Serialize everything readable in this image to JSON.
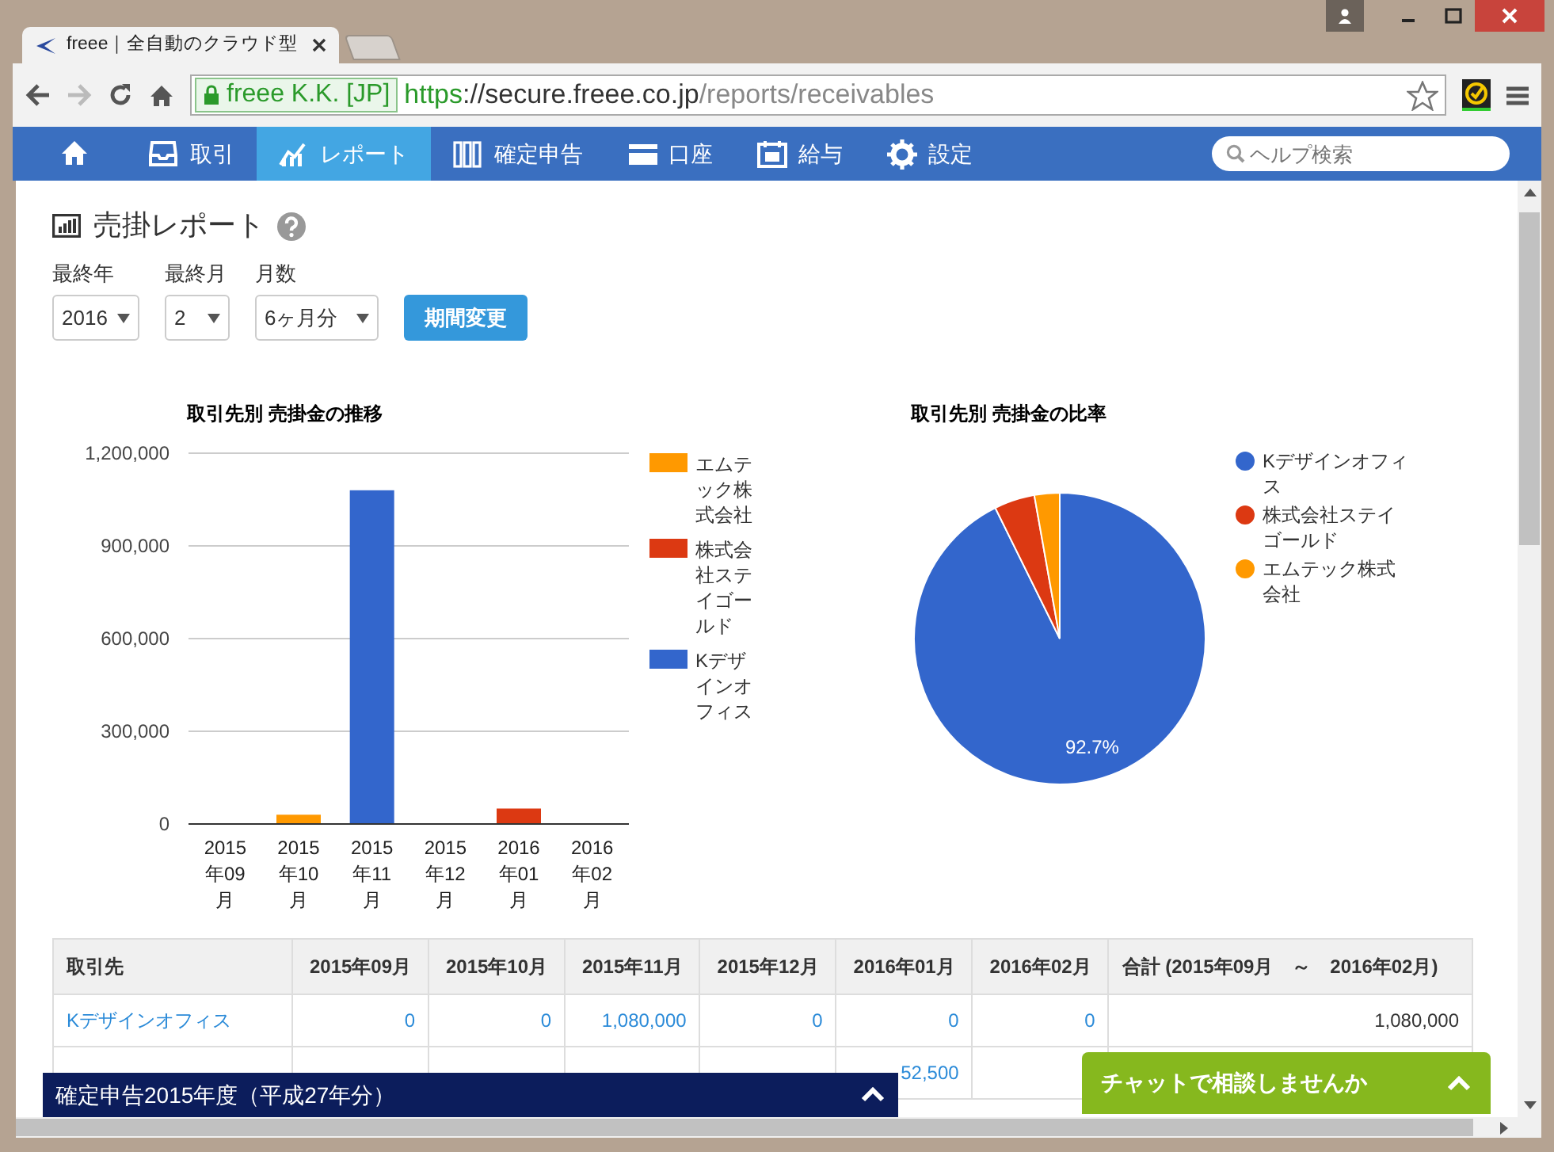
{
  "browser": {
    "tab_title": "freee｜全自動のクラウド型",
    "org": "freee K.K. [JP]",
    "url_scheme": "https",
    "url_host": "://secure.freee.co.jp",
    "url_path": "/reports/receivables"
  },
  "nav": {
    "items": [
      {
        "kind": "home",
        "selected": false
      },
      {
        "kind": "tray",
        "label": "取引",
        "selected": false
      },
      {
        "kind": "chart",
        "label": "レポート",
        "selected": true
      },
      {
        "kind": "books",
        "label": "確定申告",
        "selected": false
      },
      {
        "kind": "card",
        "label": "口座",
        "selected": false
      },
      {
        "kind": "calendar",
        "label": "給与",
        "selected": false
      },
      {
        "kind": "gear",
        "label": "設定",
        "selected": false
      }
    ],
    "search_placeholder": "ヘルプ検索"
  },
  "report": {
    "title": "売掛レポート",
    "filters": [
      {
        "label": "最終年",
        "value": "2016"
      },
      {
        "label": "最終月",
        "value": "2"
      },
      {
        "label": "月数",
        "value": "6ヶ月分"
      }
    ],
    "apply_button": "期間変更"
  },
  "bar_chart": {
    "chart_data": {
      "type": "bar",
      "title": "取引先別 売掛金の推移",
      "categories": [
        "2015年09月",
        "2015年10月",
        "2015年11月",
        "2015年12月",
        "2016年01月",
        "2016年02月"
      ],
      "ylim": [
        0,
        1200000
      ],
      "yticks": [
        {
          "value": 0,
          "label": "0"
        },
        {
          "value": 300000,
          "label": "300,000"
        },
        {
          "value": 600000,
          "label": "600,000"
        },
        {
          "value": 900000,
          "label": "900,000"
        },
        {
          "value": 1200000,
          "label": "1,200,000"
        }
      ],
      "stacked": true,
      "grid": true,
      "legend": true,
      "series": [
        {
          "name": "エムテック株式会社",
          "color": "#ff9900",
          "values": [
            0,
            30000,
            0,
            0,
            0,
            0
          ]
        },
        {
          "name": "株式会社ステイゴールド",
          "color": "#dc3912",
          "values": [
            0,
            0,
            0,
            0,
            50000,
            0
          ]
        },
        {
          "name": "Kデザインオフィス",
          "color": "#3366cc",
          "values": [
            0,
            0,
            1080000,
            0,
            0,
            0
          ]
        }
      ]
    }
  },
  "pie_chart": {
    "chart_data": {
      "type": "pie",
      "title": "取引先別 売掛金の比率",
      "categories": [
        "Kデザインオフィス",
        "株式会社ステイゴールド",
        "エムテック株式会社"
      ],
      "legend": true,
      "values": [
        92.7,
        4.5,
        2.8
      ],
      "colors": [
        "#3366cc",
        "#dc3912",
        "#ff9900"
      ],
      "value_labels": [
        "92.7%",
        null,
        null
      ]
    }
  },
  "table": {
    "columns": [
      "取引先",
      "2015年09月",
      "2015年10月",
      "2015年11月",
      "2015年12月",
      "2016年01月",
      "2016年02月",
      "合計 (2015年09月　～　2016年02月)"
    ],
    "rows": [
      {
        "cells": [
          "Kデザインオフィス",
          "0",
          "0",
          "1,080,000",
          "0",
          "0",
          "0",
          "1,080,000"
        ]
      },
      {
        "cells": [
          null,
          null,
          null,
          null,
          null,
          "52,500"
        ]
      }
    ]
  },
  "tax_bar": {
    "label": "確定申告2015年度（平成27年分）",
    "expanded": false
  },
  "chat_bar": {
    "label": "チャットで相談しませんか",
    "expanded": false
  }
}
